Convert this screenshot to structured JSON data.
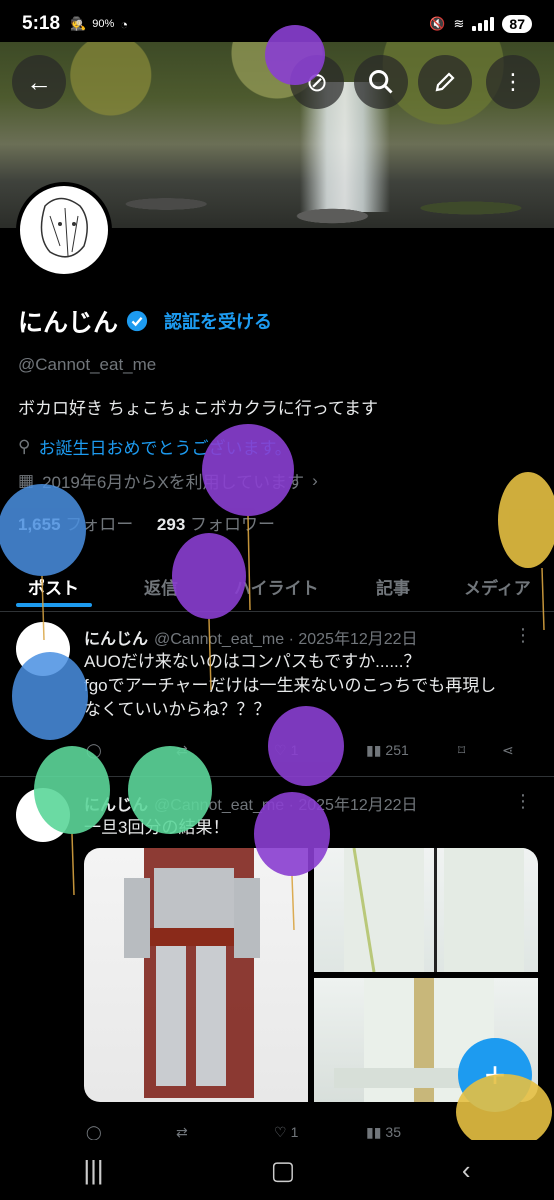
{
  "status_bar": {
    "time": "5:18",
    "percent_small": "90%",
    "battery": "87"
  },
  "header": {
    "back_icon": "arrow-left-icon",
    "actions": [
      "grok-icon",
      "search-icon",
      "edit-icon",
      "more-vertical-icon"
    ]
  },
  "profile": {
    "name": "にんじん",
    "get_verified": "認証を受ける",
    "handle": "@Cannot_eat_me",
    "bio": "ボカロ好き ちょこちょこボカクラに行ってます",
    "birthday": "お誕生日おめでとうございます。",
    "joined": "2019年6月からXを利用しています",
    "following_count": "1,655",
    "following_label": "フォロー",
    "followers_count": "293",
    "followers_label": "フォロワー"
  },
  "tabs": [
    "ポスト",
    "返信",
    "ハイライト",
    "記事",
    "メディア"
  ],
  "tweets": [
    {
      "name": "にんじん",
      "handle": "@Cannot_eat_me",
      "date": "· 2025年12月22日",
      "line1": "AUOだけ来ないのはコンパスもですか......？",
      "line2": "fgoでアーチャーだけは一生来ないのこっちでも再現し",
      "line3": "なくていいからね？？？",
      "replies": "",
      "retweets": "",
      "likes": "1",
      "views": "251"
    },
    {
      "name": "にんじん",
      "handle": "@Cannot_eat_me",
      "date": "· 2025年12月22日",
      "text": "一旦3回分の結果！",
      "replies": "",
      "retweets": "",
      "likes": "1",
      "views": "35"
    }
  ],
  "colors": {
    "accent": "#1d9bf0",
    "balloon_purple": "#8a3fd1",
    "balloon_blue": "#4a90e2",
    "balloon_green": "#5cd69a",
    "balloon_yellow": "#e6c042"
  }
}
